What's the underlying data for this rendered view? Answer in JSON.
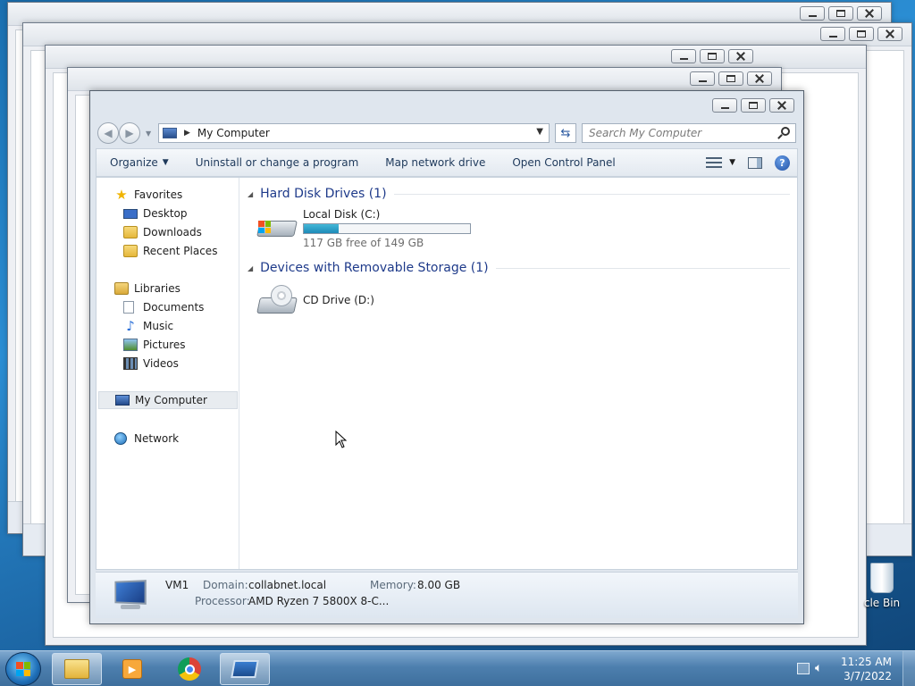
{
  "window": {
    "address_text": "My Computer",
    "search_placeholder": "Search My Computer"
  },
  "commands": {
    "organize": "Organize",
    "uninstall": "Uninstall or change a program",
    "map_drive": "Map network drive",
    "control_panel": "Open Control Panel"
  },
  "nav": {
    "favorites": "Favorites",
    "desktop": "Desktop",
    "downloads": "Downloads",
    "recent": "Recent Places",
    "libraries": "Libraries",
    "documents": "Documents",
    "music": "Music",
    "pictures": "Pictures",
    "videos": "Videos",
    "computer": "My Computer",
    "network": "Network"
  },
  "groups": {
    "hdd_title": "Hard Disk Drives (1)",
    "removable_title": "Devices with Removable Storage (1)"
  },
  "drives": {
    "c_label": "Local Disk (C:)",
    "c_free": "117 GB free of 149 GB",
    "c_used_fraction": 0.21,
    "d_label": "CD Drive (D:)"
  },
  "details": {
    "name": "VM1",
    "domain_key": "Domain:",
    "domain_val": "collabnet.local",
    "memory_key": "Memory:",
    "memory_val": "8.00 GB",
    "processor_key": "Processor:",
    "processor_val": "AMD Ryzen 7 5800X 8-C..."
  },
  "desktop": {
    "recycle_label": "cle Bin"
  },
  "taskbar": {
    "time": "11:25 AM",
    "date": "3/7/2022"
  },
  "colors": {
    "accent": "#1e3a8a",
    "usage_fill": "#1e8bb8",
    "taskbar": "#4d7fae"
  }
}
